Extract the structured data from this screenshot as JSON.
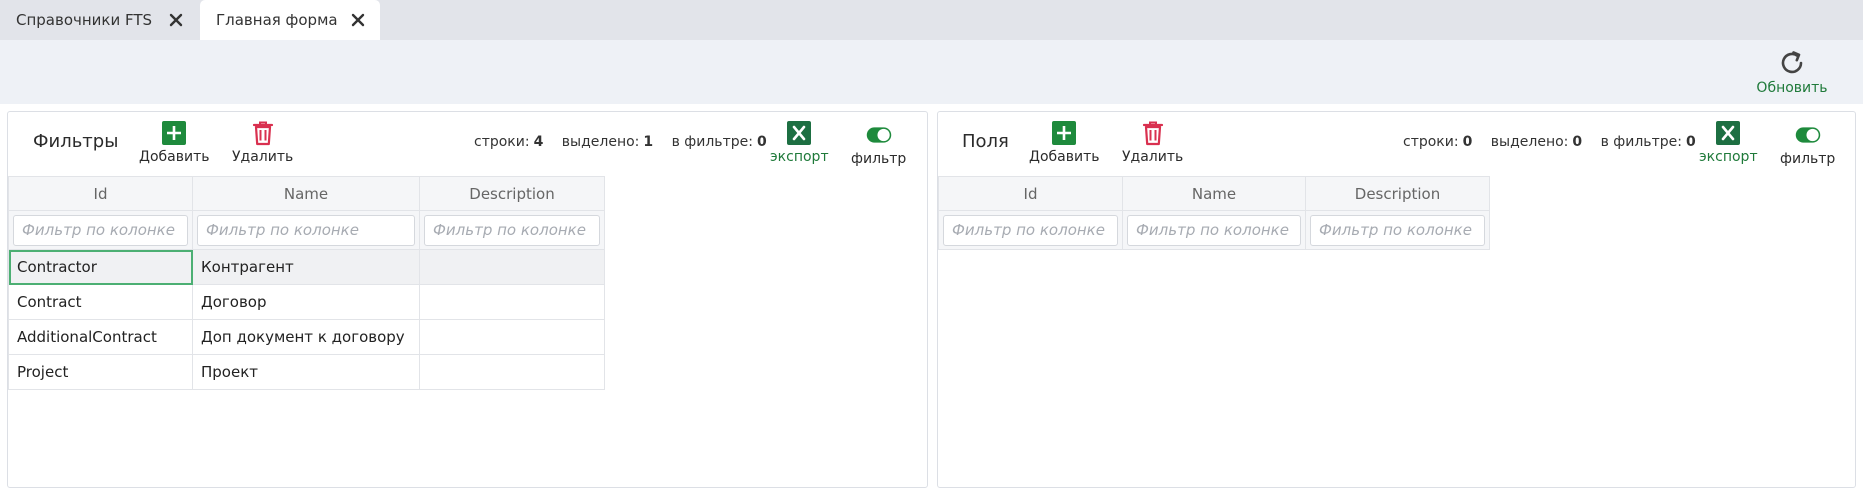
{
  "tabs": [
    {
      "label": "Справочники FTS",
      "active": false
    },
    {
      "label": "Главная форма",
      "active": true
    }
  ],
  "toolbar": {
    "refresh_label": "Обновить"
  },
  "panels": {
    "left": {
      "title": "Фильтры",
      "add_label": "Добавить",
      "delete_label": "Удалить",
      "rows_label": "строки:",
      "rows_value": "4",
      "selected_label": "выделено:",
      "selected_value": "1",
      "in_filter_label": "в фильтре:",
      "in_filter_value": "0",
      "export_label": "экспорт",
      "filter_label": "фильтр",
      "filter_toggle_on": true,
      "columns": [
        "Id",
        "Name",
        "Description"
      ],
      "filter_placeholder": "Фильтр по колонке",
      "rows": [
        {
          "id": "Contractor",
          "name": "Контрагент",
          "description": ""
        },
        {
          "id": "Contract",
          "name": "Договор",
          "description": ""
        },
        {
          "id": "AdditionalContract",
          "name": "Доп документ к договору",
          "description": ""
        },
        {
          "id": "Project",
          "name": "Проект",
          "description": ""
        }
      ]
    },
    "right": {
      "title": "Поля",
      "add_label": "Добавить",
      "delete_label": "Удалить",
      "rows_label": "строки:",
      "rows_value": "0",
      "selected_label": "выделено:",
      "selected_value": "0",
      "in_filter_label": "в фильтре:",
      "in_filter_value": "0",
      "export_label": "экспорт",
      "filter_label": "фильтр",
      "filter_toggle_on": true,
      "columns": [
        "Id",
        "Name",
        "Description"
      ],
      "filter_placeholder": "Фильтр по колонке",
      "rows": []
    }
  },
  "colors": {
    "accent_green": "#1f7a3a",
    "add_green": "#1e8a3c",
    "delete_red": "#d9304f",
    "excel_green": "#1d6f42"
  },
  "icons": {
    "tab_close": "close-icon",
    "refresh": "refresh-icon",
    "add": "plus-square-icon",
    "delete": "trash-icon",
    "export": "excel-icon",
    "filter": "toggle-switch-icon"
  }
}
